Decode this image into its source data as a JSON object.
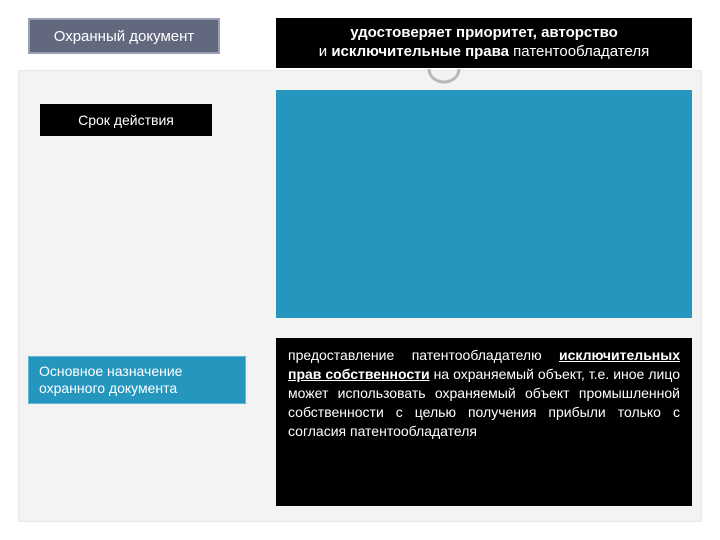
{
  "row1": {
    "label": "Охранный документ",
    "body_strong": "удостоверяет приоритет, авторство",
    "body_rest_prefix": "и ",
    "body_rest_strong": "исключительные права",
    "body_rest_suffix": " патентообладателя"
  },
  "row2": {
    "label": "Срок действия"
  },
  "row3": {
    "label_line1": "Основное назначение",
    "label_line2": " охранного документа",
    "body_pre": "предоставление патентообладателю ",
    "body_u": "исключительных прав собственности",
    "body_post": " на охраняемый объект, т.е. иное лицо может использовать охраняемый объект промышленной собственности с целью получения прибыли только с согласия патентообладателя"
  }
}
